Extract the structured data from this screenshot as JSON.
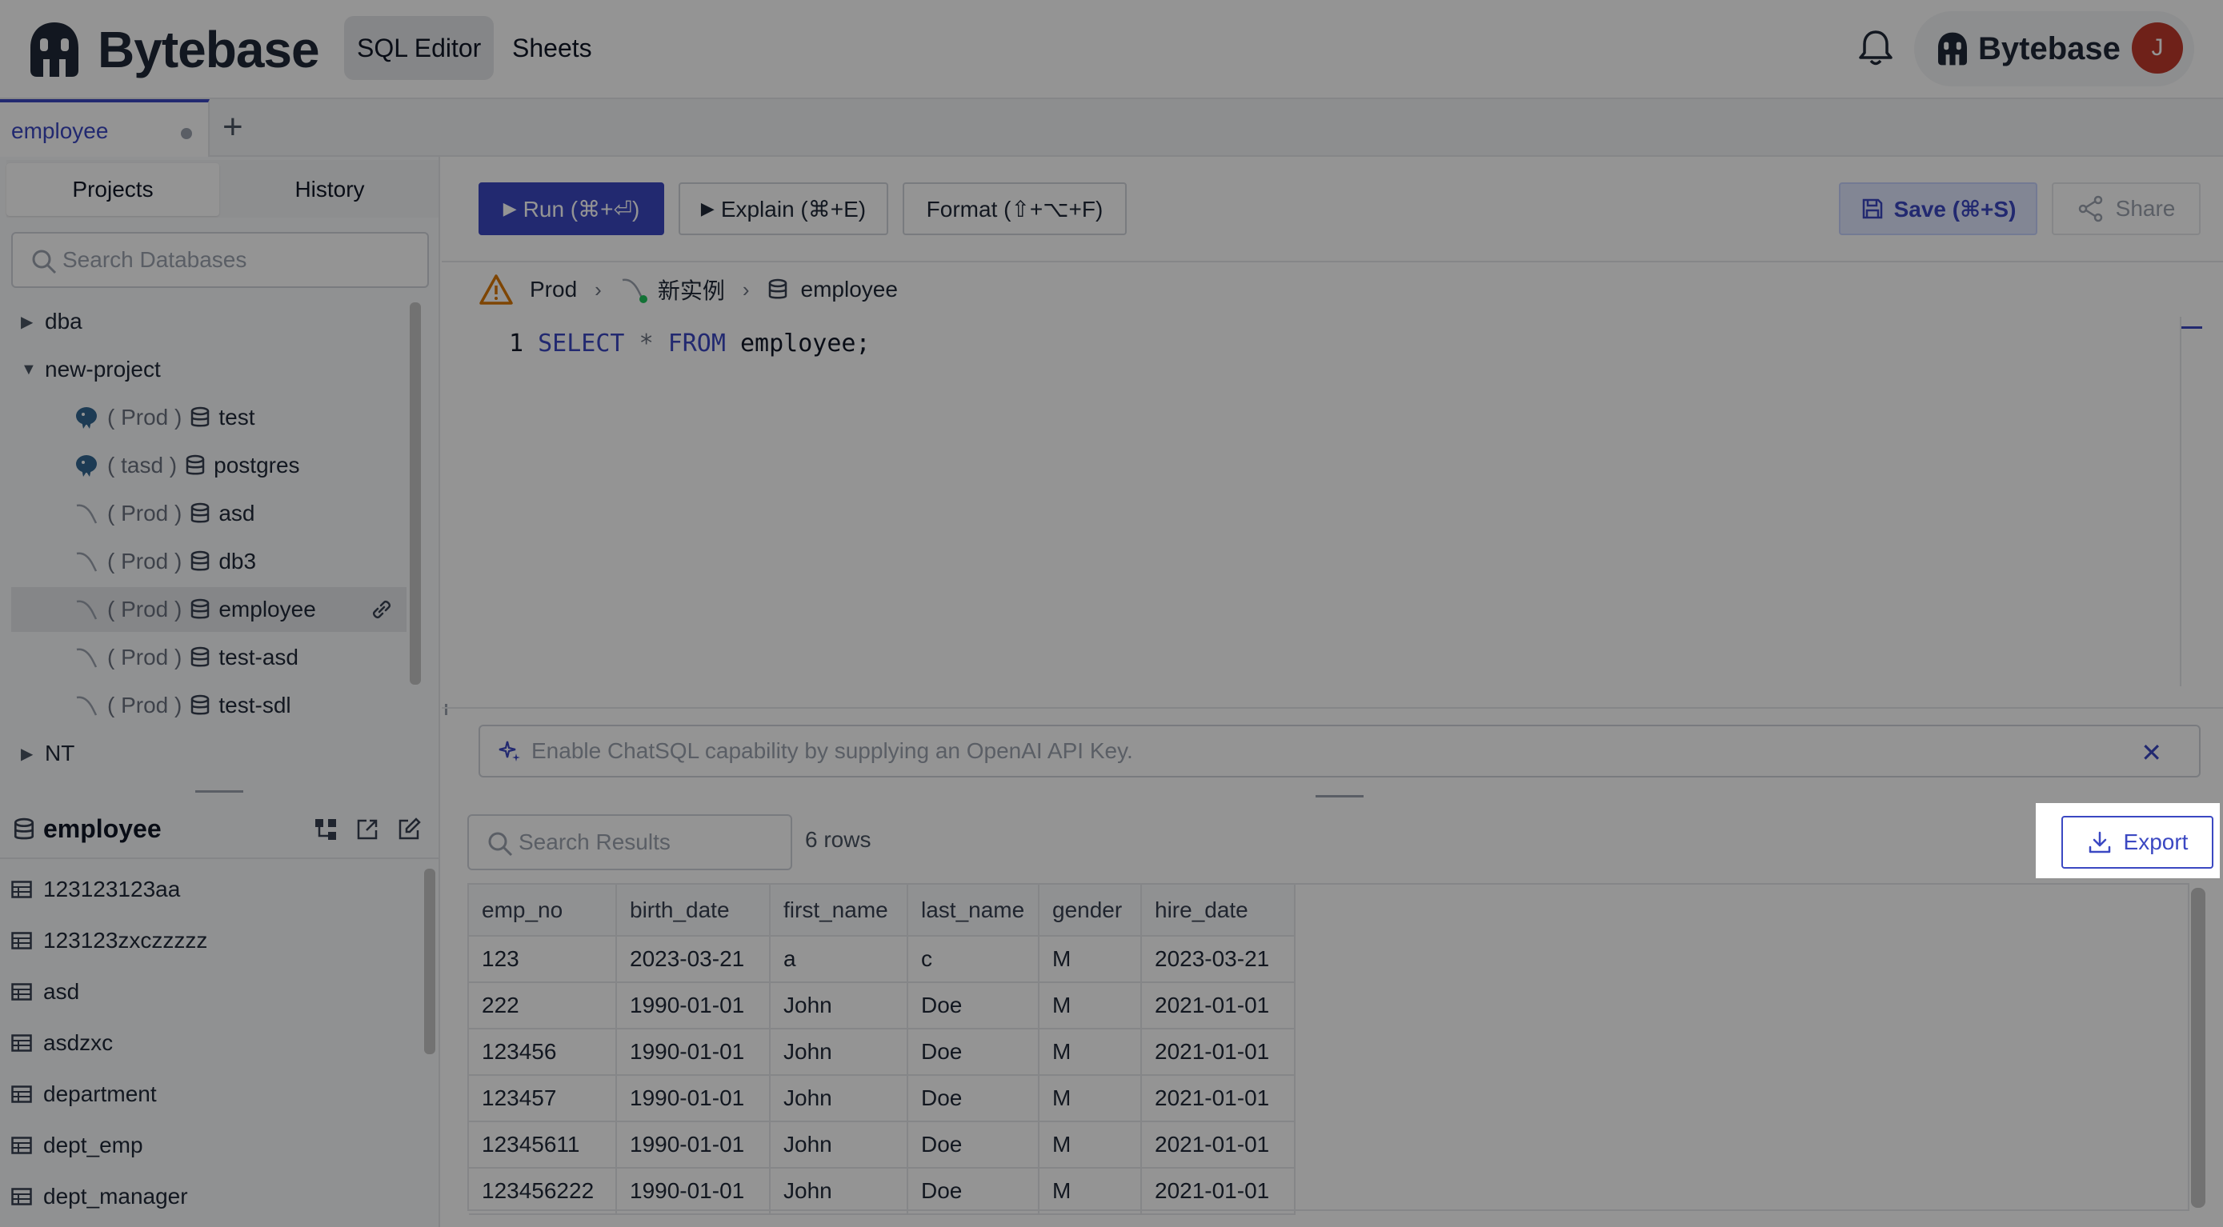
{
  "header": {
    "brand": "Bytebase",
    "nav": [
      "SQL Editor",
      "Sheets"
    ],
    "user_brand": "Bytebase",
    "avatar_initial": "J"
  },
  "tabs": [
    {
      "label": "employee"
    }
  ],
  "sidebar": {
    "segments": [
      "Projects",
      "History"
    ],
    "search_placeholder": "Search Databases",
    "tree": [
      {
        "label": "dba"
      },
      {
        "label": "new-project"
      },
      {
        "env": "( Prod )",
        "label": "test"
      },
      {
        "env": "( tasd )",
        "label": "postgres"
      },
      {
        "env": "( Prod )",
        "label": "asd"
      },
      {
        "env": "( Prod )",
        "label": "db3"
      },
      {
        "env": "( Prod )",
        "label": "employee"
      },
      {
        "env": "( Prod )",
        "label": "test-asd"
      },
      {
        "env": "( Prod )",
        "label": "test-sdl"
      },
      {
        "label": "NT"
      }
    ],
    "db_title": "employee",
    "tables": [
      "123123123aa",
      "123123zxczzzzz",
      "asd",
      "asdzxc",
      "department",
      "dept_emp",
      "dept_manager"
    ]
  },
  "toolbar": {
    "run": "Run (⌘+⏎)",
    "explain": "Explain (⌘+E)",
    "format": "Format (⇧+⌥+F)",
    "save": "Save (⌘+S)",
    "share": "Share"
  },
  "breadcrumb": {
    "env": "Prod",
    "instance": "新实例",
    "database": "employee"
  },
  "editor": {
    "line": "1",
    "kw1": "SELECT",
    "op": "*",
    "kw2": "FROM",
    "rest": "employee;"
  },
  "chat": {
    "text": "Enable ChatSQL capability by supplying an OpenAI API Key."
  },
  "results": {
    "search_placeholder": "Search Results",
    "row_count": "6 rows",
    "export": "Export",
    "columns": [
      "emp_no",
      "birth_date",
      "first_name",
      "last_name",
      "gender",
      "hire_date"
    ],
    "rows": [
      [
        "123",
        "2023-03-21",
        "a",
        "c",
        "M",
        "2023-03-21"
      ],
      [
        "222",
        "1990-01-01",
        "John",
        "Doe",
        "M",
        "2021-01-01"
      ],
      [
        "123456",
        "1990-01-01",
        "John",
        "Doe",
        "M",
        "2021-01-01"
      ],
      [
        "123457",
        "1990-01-01",
        "John",
        "Doe",
        "M",
        "2021-01-01"
      ],
      [
        "12345611",
        "1990-01-01",
        "John",
        "Doe",
        "M",
        "2021-01-01"
      ],
      [
        "123456222",
        "1990-01-01",
        "John",
        "Doe",
        "M",
        "2021-01-01"
      ]
    ]
  },
  "colors": {
    "accent": "#3b48c2",
    "warning": "#d97706",
    "avatar": "#c0392b"
  }
}
